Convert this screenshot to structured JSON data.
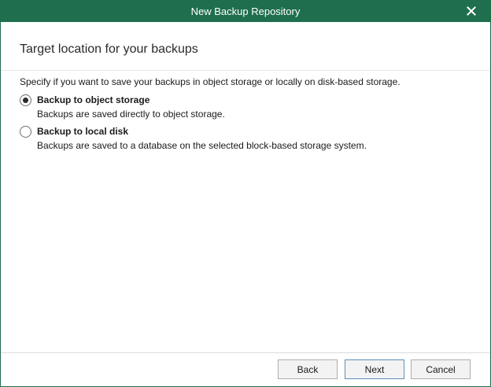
{
  "window": {
    "title": "New Backup Repository",
    "accent_color": "#1f6f4f",
    "close_icon": "close-icon"
  },
  "header": {
    "title": "Target location for your backups"
  },
  "content": {
    "description": "Specify if you want to save your backups in object storage or locally on disk-based storage.",
    "options": [
      {
        "label": "Backup to object storage",
        "sublabel": "Backups are saved directly to object storage.",
        "selected": true
      },
      {
        "label": "Backup to local disk",
        "sublabel": "Backups are saved to a database on the selected block-based storage system.",
        "selected": false
      }
    ]
  },
  "footer": {
    "back_label": "Back",
    "next_label": "Next",
    "cancel_label": "Cancel"
  }
}
